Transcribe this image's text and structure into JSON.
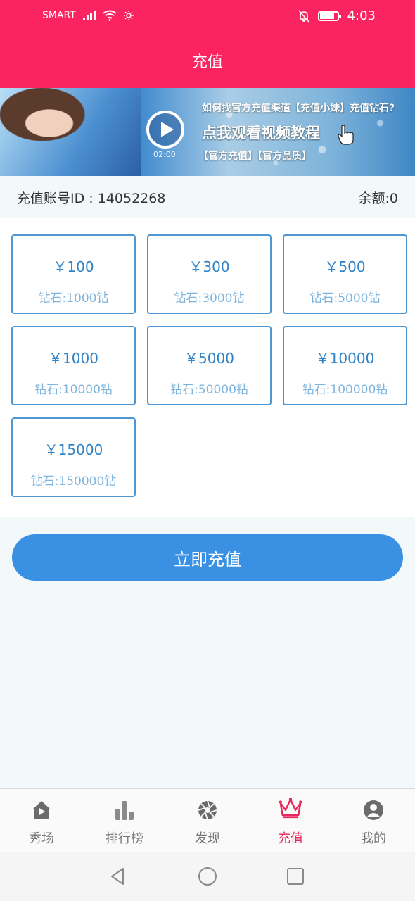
{
  "status_bar": {
    "carrier": "SMART",
    "time": "4:03",
    "battery_level": 0.85
  },
  "header": {
    "title": "充值"
  },
  "banner": {
    "line1": "如何找官方充值渠道【充值小妹】充值钻石?",
    "line2": "点我观看视频教程",
    "line3": "【官方充值】【官方品质】",
    "video_duration": "02:00"
  },
  "account": {
    "id_label": "充值账号ID : 14052268",
    "balance_label": "余额:0"
  },
  "packages": [
    {
      "price": "￥100",
      "diamonds": "钻石:1000钻"
    },
    {
      "price": "￥300",
      "diamonds": "钻石:3000钻"
    },
    {
      "price": "￥500",
      "diamonds": "钻石:5000钻"
    },
    {
      "price": "￥1000",
      "diamonds": "钻石:10000钻"
    },
    {
      "price": "￥5000",
      "diamonds": "钻石:50000钻"
    },
    {
      "price": "￥10000",
      "diamonds": "钻石:100000钻"
    },
    {
      "price": "￥15000",
      "diamonds": "钻石:150000钻"
    }
  ],
  "recharge_button": {
    "label": "立即充值"
  },
  "tabbar": {
    "items": [
      {
        "label": "秀场",
        "icon": "home-icon"
      },
      {
        "label": "排行榜",
        "icon": "ranking-icon"
      },
      {
        "label": "发现",
        "icon": "discover-icon"
      },
      {
        "label": "充值",
        "icon": "crown-icon"
      },
      {
        "label": "我的",
        "icon": "profile-icon"
      }
    ],
    "active_index": 3,
    "active_color": "#e8275e",
    "inactive_color": "#777777"
  },
  "colors": {
    "brand": "#fb2460",
    "button": "#3a91e4",
    "package_border": "#4e97d2"
  }
}
